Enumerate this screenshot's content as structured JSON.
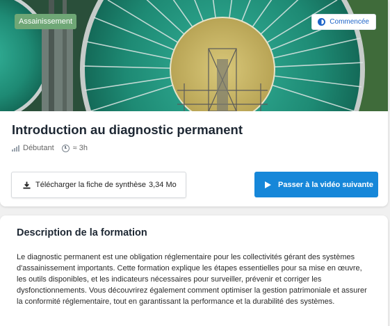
{
  "course": {
    "category": "Assainissement",
    "status": "Commencée",
    "title": "Introduction au diagnostic permanent",
    "level": "Débutant",
    "duration": "≈ 3h"
  },
  "actions": {
    "download_label": "Télécharger la fiche de synthèse",
    "download_size": "3,34 Mo",
    "next_label": "Passer à la vidéo suivante"
  },
  "description": {
    "heading": "Description de la formation",
    "text": "Le diagnostic permanent est une obligation réglementaire pour les collectivités gérant des systèmes d'assainissement importants. Cette formation explique les étapes essentielles pour sa mise en œuvre, les outils disponibles, et les indicateurs nécessaires pour surveiller, prévenir et corriger les dysfonctionnements. Vous découvrirez également comment optimiser la gestion patrimoniale et assurer la conformité réglementaire, tout en garantissant la performance et la durabilité des systèmes."
  },
  "colors": {
    "category_badge": "#6fa776",
    "status_text": "#1c63c8",
    "primary_button": "#1687d9"
  }
}
